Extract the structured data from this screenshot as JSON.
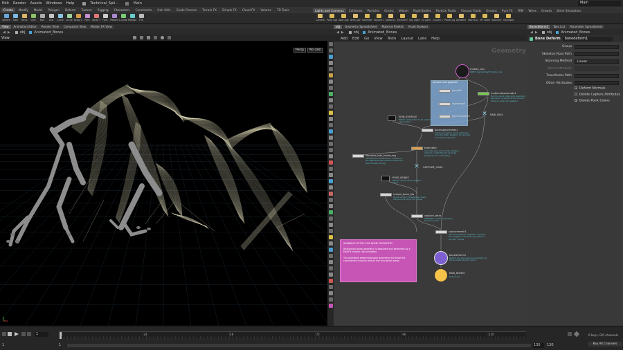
{
  "menubar": {
    "items": [
      "Edit",
      "Render",
      "Assets",
      "Windows",
      "Help"
    ],
    "scene_name": "Technical_Spli…",
    "desktop": "Main",
    "desktop_right": "Main"
  },
  "shelf_tabs": [
    "Create",
    "Modify",
    "Model",
    "Polygon",
    "Deform",
    "Texture",
    "Rigging",
    "Characters",
    "Constraints",
    "Hair Utils",
    "Guide Process",
    "Terrain FX",
    "Simple FX",
    "Cloud FX",
    "Volume",
    "TD Tools"
  ],
  "shelf_tabs_right": [
    "Lights and Cameras",
    "Collisions",
    "Particles",
    "Grains",
    "Vellum",
    "Rigid Bodies",
    "Particle Fluids",
    "Viscous Fluids",
    "Oceans",
    "Pyro FX",
    "FEM",
    "Wires",
    "Crowds",
    "Drive Simulation"
  ],
  "shelf_tools_left": [
    "Sphere",
    "Tube",
    "Torus",
    "Grid",
    "Null",
    "Line",
    "Circle",
    "Curve",
    "Draw Curve",
    "Path",
    "Spray Paint",
    "Font",
    "Platonic Solids",
    "L-System",
    "Metaball",
    "File"
  ],
  "shelf_tools_right": [
    "Camera",
    "Point Light",
    "Spot Light",
    "Area Light",
    "Geometry Light",
    "Volume Light",
    "Distant Light",
    "Environment Light",
    "Sky Light",
    "GI Light",
    "Caustic Light",
    "Portal Light",
    "Ambient Light",
    "Stereo Camera",
    "VR Camera",
    "Switcher",
    "Gamepad Camera"
  ],
  "pane_tabs_viewer": [
    "View",
    "Animation Editor",
    "Render View",
    "Composite View",
    "Motion FX View"
  ],
  "pane_tabs_network": [
    "obj",
    "Geometry Spreadsheet",
    "Material Palette",
    "Asset Browser"
  ],
  "pane_tabs_params": [
    "Bonedeform1",
    "Take List",
    "Parameter Spreadsheet"
  ],
  "viewer": {
    "path_obj": "obj",
    "path_node": "Animated_Bones",
    "view_label": "View",
    "persp": "Persp",
    "cam": "No cam"
  },
  "network": {
    "path_obj": "obj",
    "path_node": "Animated_Bones",
    "menu": [
      "Add",
      "Edit",
      "Go",
      "View",
      "Tools",
      "Layout",
      "Labs",
      "Help"
    ],
    "context_label": "Geometry",
    "nodes": {
      "motion_clip": "motion_clip",
      "motion_clip_comment": "INPUT: Cached Rest/T-motion clip",
      "group_title": "extract rest position",
      "group_n1": "bonelift",
      "group_n2": "objmerge5",
      "group_n3": "ligmentspect4",
      "motionclipevaluate": "motionclipevaluate1",
      "motionclip_comment": "Pick the input motionclip, geometry, segments, evaluate at the current frame to return the skeleton",
      "raw_skel": "RAW_SKEL",
      "skin_surface": "SKIN_SURFACE",
      "skin_comment": "INPUT: Cached Skin to be capture interpolated",
      "bonecapturelines": "bonecapturelines1",
      "bonecap_comment": "Add bone capture points attributes from the Static Skeleton for skinning and deforming bones",
      "tetembed": "tetembed",
      "tetembed_comment": "Converts each point of the skeleton mesh to a tight fit-point at linked tetrahedron to embedding",
      "visualize": "visualize_tets_inside_leg",
      "visualize_comment": "Visualize the tetrahedrons created by the TetEmbed SOP. Use the Distance to step through the leg",
      "capture_cage": "CAPTURE_CAGE",
      "pose_bones": "POSE_BONES",
      "pose_comment": "INPUT: Cached Static skeleton bones",
      "unique_bone": "unique_bone_ids",
      "unique_comment": "Group surface consistently create unique bone ids to sort proper",
      "capture_tetra": "capture_tetra",
      "capture_tetra_comment": "WARNING: Capture geometry bones to avoid",
      "capturemesh": "capturemesh1",
      "capturemesh_comment": "Use bone capture weights to compute the weights on the pose geometry to the skin / bones",
      "bonedeform": "bonedeform1",
      "bonedeform_comment": "Deform the skinned bone geometry by the animated KineFX joints",
      "raw_bones": "RAW_BONES",
      "raw_bones_comment": "Output skin",
      "sticky_title": "SKINNING SETUP FOR BONE GEOMETRY",
      "sticky_p1": "Anatomical bone geometry is captured and deformed by a KineFX motion clip animation.",
      "sticky_p2": "The animated deforming bone geometry will drive the constrained muscles and all the simulation steps."
    }
  },
  "params": {
    "node_type": "Bone Deform",
    "node_name": "bonedeform1",
    "rows": [
      {
        "label": "Group",
        "value": ""
      },
      {
        "label": "Skeleton Root Path",
        "value": ""
      },
      {
        "label": "Skinning Method",
        "value": "Linear"
      },
      {
        "label": "Blend Attribute",
        "value": ""
      },
      {
        "label": "Transforms Path",
        "value": ""
      },
      {
        "label": "Other Attributes",
        "value": ""
      }
    ],
    "checks": [
      {
        "label": "Deform Normals",
        "checked": "✓"
      },
      {
        "label": "Delete Capture Attributes",
        "checked": ""
      },
      {
        "label": "Delete Point Colors",
        "checked": "✓"
      }
    ]
  },
  "timeline": {
    "frame": "1",
    "start": "1",
    "start2": "1",
    "ticks": [
      "1",
      "24",
      "48",
      "72",
      "96",
      "120"
    ],
    "end": "130",
    "end2": "130",
    "keys": "0 keys, 0/0 channels",
    "key_all": "Key All Channels"
  },
  "colors": {
    "accent": "#f5c24a",
    "node_cyan": "#58b7c7",
    "sticky": "#c655b6",
    "group_box": "#7fa6d1"
  }
}
